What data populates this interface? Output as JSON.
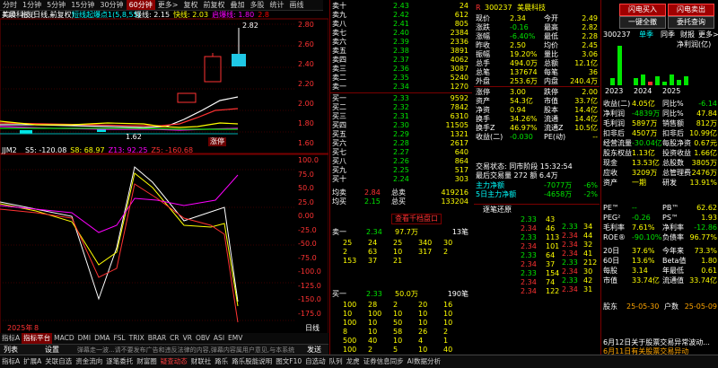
{
  "toolbar": {
    "items": [
      "分时",
      "1分钟",
      "5分钟",
      "15分钟",
      "30分钟",
      "60分钟",
      "更多>",
      "复权",
      "前复权",
      "叠加",
      "多股",
      "统计",
      "画线",
      "F10",
      "标记",
      "-",
      "+"
    ],
    "active_index": 5
  },
  "chart": {
    "title": "美晨科技(日线,前复权)",
    "indicator_label": "短线起爆点1(5,8,55)",
    "indicator_values": [
      {
        "text": "慢线: 2.15",
        "color": "#ffffff"
      },
      {
        "text": "快线: 2.03",
        "color": "#ffff00"
      },
      {
        "text": "启爆线: 1.80",
        "color": "#ff00ff"
      },
      {
        "text": "2.8",
        "color": "#ff0000"
      }
    ],
    "price_axis": [
      "2.80",
      "2.60",
      "2.40",
      "2.20",
      "2.00",
      "1.80",
      "1.60"
    ],
    "high_label": "2.82",
    "low_label": "1.62",
    "stock_tag": "涨停",
    "sub_indicator": "JJM2",
    "sub_values": [
      {
        "text": "S5: -120.08",
        "color": "#ffffff"
      },
      {
        "text": "S8: 68.97",
        "color": "#ffff00"
      },
      {
        "text": "Z13: 92.25",
        "color": "#ff00ff"
      },
      {
        "text": "Z5: -160.68",
        "color": "#ff3232"
      }
    ],
    "sub_axis": [
      "100.0",
      "75.0",
      "50.0",
      "25.0",
      "0.00",
      "-25.0",
      "-50.0",
      "-75.0",
      "-100.0",
      "-125.0",
      "-150.0",
      "-175.0"
    ],
    "year_label": "2025年",
    "month_label": "8",
    "right_label": "日线"
  },
  "tabs_row": [
    "指标A",
    "指标平台",
    "MACD",
    "DMI",
    "DMA",
    "FSL",
    "TRIX",
    "BRAR",
    "CR",
    "VR",
    "OBV",
    "ASI",
    "EMV"
  ],
  "ticker_bar": {
    "list_label": "列表",
    "settings_label": "设置",
    "scroll_text": "弹幕走一波...请不要发布广告和违反法律的内容,弹幕内容属用户意见,与本系统",
    "send_label": "发送"
  },
  "order_book": {
    "sell": [
      {
        "label": "卖十",
        "price": "2.43",
        "vol": "24"
      },
      {
        "label": "卖九",
        "price": "2.42",
        "vol": "612"
      },
      {
        "label": "卖八",
        "price": "2.41",
        "vol": "805"
      },
      {
        "label": "卖七",
        "price": "2.40",
        "vol": "2384"
      },
      {
        "label": "卖六",
        "price": "2.39",
        "vol": "2336"
      },
      {
        "label": "卖五",
        "price": "2.38",
        "vol": "3891"
      },
      {
        "label": "卖四",
        "price": "2.37",
        "vol": "4062"
      },
      {
        "label": "卖三",
        "price": "2.36",
        "vol": "3087"
      },
      {
        "label": "卖二",
        "price": "2.35",
        "vol": "5240"
      },
      {
        "label": "卖一",
        "price": "2.34",
        "vol": "1270"
      }
    ],
    "buy": [
      {
        "label": "买一",
        "price": "2.33",
        "vol": "9592"
      },
      {
        "label": "买二",
        "price": "2.32",
        "vol": "7842"
      },
      {
        "label": "买三",
        "price": "2.31",
        "vol": "6310"
      },
      {
        "label": "买四",
        "price": "2.30",
        "vol": "11505"
      },
      {
        "label": "买五",
        "price": "2.29",
        "vol": "1321"
      },
      {
        "label": "买六",
        "price": "2.28",
        "vol": "2617"
      },
      {
        "label": "买七",
        "price": "2.27",
        "vol": "640"
      },
      {
        "label": "买八",
        "price": "2.26",
        "vol": "864"
      },
      {
        "label": "买九",
        "price": "2.25",
        "vol": "517"
      },
      {
        "label": "买十",
        "price": "2.24",
        "vol": "303"
      }
    ],
    "avg_sell": {
      "label": "均卖",
      "price": "2.84",
      "tlabel": "总卖",
      "vol": "419216"
    },
    "avg_buy": {
      "label": "均买",
      "price": "2.15",
      "tlabel": "总买",
      "vol": "133204"
    },
    "view_button": "查看千档盘口",
    "sell1_row": {
      "label": "卖一",
      "price": "2.34",
      "qty": "97.7万",
      "count": "13笔"
    },
    "sell_queue": [
      [
        "25",
        "24",
        "25",
        "340",
        "30"
      ],
      [
        "2",
        "63",
        "10",
        "317",
        "2"
      ],
      [
        "153",
        "37",
        "21",
        "",
        ""
      ]
    ],
    "buy1_row": {
      "label": "买一",
      "price": "2.33",
      "qty": "50.0万",
      "count": "190笔"
    },
    "buy_queue": [
      [
        "100",
        "28",
        "2",
        "20",
        "16"
      ],
      [
        "10",
        "100",
        "10",
        "10",
        "10"
      ],
      [
        "100",
        "10",
        "50",
        "10",
        "10"
      ],
      [
        "8",
        "10",
        "58",
        "26",
        "2"
      ],
      [
        "500",
        "40",
        "10",
        "4",
        "1"
      ],
      [
        "100",
        "2",
        "5",
        "10",
        "40"
      ]
    ]
  },
  "quote": {
    "code": "300237",
    "name": "美晨科技",
    "rows": [
      {
        "l": "现价",
        "v": "2.34",
        "l2": "今开",
        "v2": "2.49"
      },
      {
        "l": "涨跌",
        "v": "-0.16",
        "l2": "最高",
        "v2": "2.82"
      },
      {
        "l": "涨幅",
        "v": "-6.40%",
        "l2": "最低",
        "v2": "2.28"
      },
      {
        "l": "昨收",
        "v": "2.50",
        "l2": "均价",
        "v2": "2.45"
      },
      {
        "l": "振幅",
        "v": "19.20%",
        "l2": "量比",
        "v2": "3.06"
      },
      {
        "l": "总手",
        "v": "494.0万",
        "l2": "总额",
        "v2": "12.1亿"
      },
      {
        "l": "总笔",
        "v": "137674",
        "l2": "每笔",
        "v2": "36"
      },
      {
        "l": "外盘",
        "v": "253.6万",
        "l2": "内盘",
        "v2": "240.4万"
      },
      {
        "l": "涨停",
        "v": "3.00",
        "l2": "跌停",
        "v2": "2.00"
      },
      {
        "l": "资产",
        "v": "54.3亿",
        "l2": "市值",
        "v2": "33.7亿"
      },
      {
        "l": "净资",
        "v": "0.94",
        "l2": "股本",
        "v2": "14.4亿"
      },
      {
        "l": "换手",
        "v": "34.26%",
        "l2": "流通",
        "v2": "14.4亿"
      },
      {
        "l": "换手Z",
        "v": "46.97%",
        "l2": "流通Z",
        "v2": "10.5亿"
      },
      {
        "l": "收益(二)",
        "v": "-0.030",
        "l2": "PE(动)",
        "v2": "--"
      }
    ],
    "trade_status": "交易状态: 同市阶段 15:32:54",
    "last_trade": "最后交易量 272 额 6.4万",
    "main_net": {
      "label": "主力净额",
      "value": "-7077万",
      "pct": "-6%"
    },
    "net5": {
      "label": "5日主力净额",
      "value": "-4658万",
      "pct": "-2%"
    },
    "list_header": "逐笔还原",
    "tick_prices": [
      "2.33",
      "2.34",
      "2.33",
      "2.34",
      "2.33",
      "2.34",
      "2.33",
      "2.34",
      "2.34",
      "2.33",
      "2.34",
      "2.34",
      "2.34",
      "2.33",
      "2.34",
      "2.33",
      "2.34"
    ],
    "tick_vols": [
      "43",
      "46",
      "113",
      "101",
      "64",
      "37",
      "154",
      "74",
      "122",
      "34",
      "44",
      "32",
      "41",
      "212",
      "30",
      "42",
      "31"
    ]
  },
  "right_panel": {
    "btn_flash_buy": "闪电买入",
    "btn_flash_sell": "闪电卖出",
    "btn_one_key": "一键全撤",
    "btn_entrust": "委托查询",
    "code": "300237",
    "tab_single": "单季",
    "tab_yoy": "同季",
    "tab_finance": "财报",
    "tab_more": "更多>",
    "chart_label": "净利润(亿)",
    "years": [
      "2023",
      "2024",
      "2025"
    ],
    "fin_rows": [
      {
        "l": "收益(二)",
        "v": "4.05亿",
        "l2": "同比%",
        "v2": "-6.14"
      },
      {
        "l": "净利润",
        "v": "-4839万",
        "l2": "同比%",
        "v2": "47.84"
      },
      {
        "l": "毛利润",
        "v": "5897万",
        "l2": "销售额",
        "v2": "812万"
      },
      {
        "l": "扣非后",
        "v": "4507万",
        "l2": "扣非后",
        "v2": "10.99亿"
      },
      {
        "l": "经营流量",
        "v": "-30.04亿",
        "l2": "每股净资",
        "v2": "0.67元"
      },
      {
        "l": "股东权益",
        "v": "1.13亿",
        "l2": "投资收益",
        "v2": "1.66亿"
      },
      {
        "l": "现金",
        "v": "13.53亿",
        "l2": "总股数",
        "v2": "3805万"
      },
      {
        "l": "应收",
        "v": "3209万",
        "l2": "总管理费",
        "v2": "2476万"
      },
      {
        "l": "资产",
        "v": "一期",
        "l2": "研发",
        "v2": "13.91%"
      }
    ],
    "val_rows": [
      {
        "l": "PE™",
        "v": "--",
        "l2": "PB™",
        "v2": "62.62"
      },
      {
        "l": "PEG²",
        "v": "-0.26",
        "l2": "PS™",
        "v2": "1.93"
      },
      {
        "l": "毛利率",
        "v": "7.61%",
        "l2": "净利率",
        "v2": "-12.86"
      },
      {
        "l": "ROE®",
        "v": "-90.10%",
        "l2": "负债率",
        "v2": "96.77%"
      },
      {
        "l": "20日",
        "v": "37.6%",
        "l2": "今年来",
        "v2": "73.3%"
      },
      {
        "l": "60日",
        "v": "13.6%",
        "l2": "Beta值",
        "v2": "1.80"
      },
      {
        "l": "每股",
        "v": "3.14",
        "l2": "年最低",
        "v2": "0.61"
      },
      {
        "l": "市值",
        "v": "33.74亿",
        "l2": "流通值",
        "v2": "33.74亿"
      }
    ],
    "shareholder": {
      "l": "股东",
      "d1": "25-05-30",
      "l2": "户数",
      "d2": "25-05-09"
    },
    "news": "6月12日关于股票交易异常波动...",
    "news2": "6月11日有关股票交易异动"
  },
  "bottom_bar": {
    "items": [
      "指标A",
      "扩展A",
      "关联自选",
      "资金流向",
      "逐笔委托",
      "财富圈",
      "疑查动态",
      "财联社",
      "路乐",
      "路乐股能说明",
      "图文F10",
      "自选动",
      "队列",
      "龙虎",
      "证券信息同步",
      "AI数据分析"
    ],
    "active_index": 6
  }
}
